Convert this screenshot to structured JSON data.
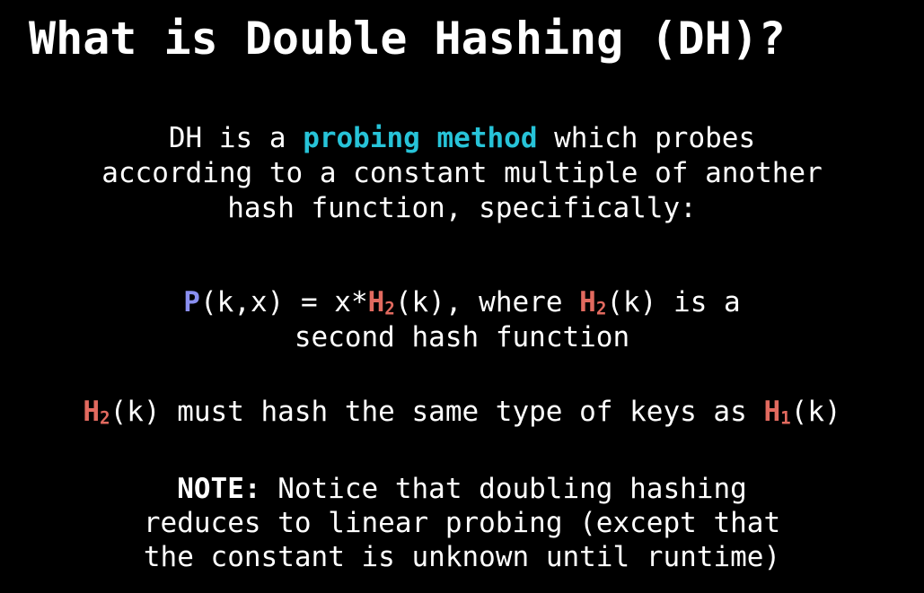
{
  "slide": {
    "title": "What is Double Hashing (DH)?",
    "intro": {
      "part1": "DH is a ",
      "highlight": "probing method",
      "part2": " which probes",
      "line2": "according to a constant multiple of another",
      "line3": "hash function, specifically:"
    },
    "formula": {
      "p": "P",
      "p_args": "(k,x) = x*",
      "h": "H",
      "h_sub": "2",
      "h_args": "(k), where ",
      "h2": "H",
      "h2_sub": "2",
      "h2_args": "(k) is a",
      "line2": "second hash function"
    },
    "constraint": {
      "h": "H",
      "h_sub": "2",
      "mid": "(k) must hash the same type of keys as ",
      "h1": "H",
      "h1_sub": "1",
      "end": "(k)"
    },
    "note": {
      "label": "NOTE:",
      "line1": " Notice that doubling hashing",
      "line2": "reduces to linear probing (except that",
      "line3": "the constant is unknown until runtime)"
    },
    "colors": {
      "background": "#000000",
      "text": "#ffffff",
      "highlight_cyan": "#27c3d8",
      "highlight_purple": "#8a8ff0",
      "highlight_red": "#e26a5f"
    }
  }
}
